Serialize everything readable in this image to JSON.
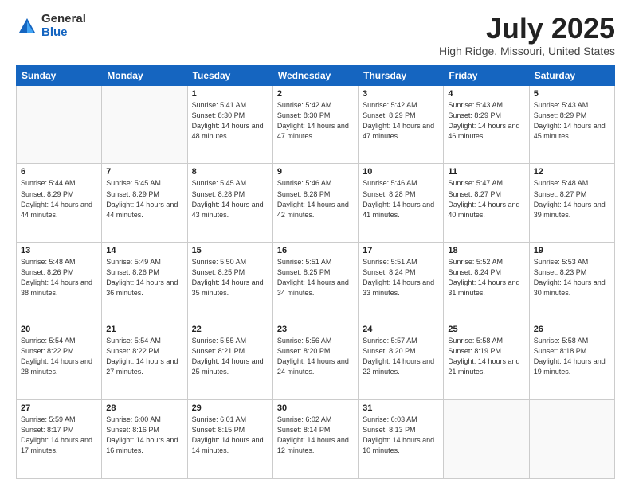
{
  "logo": {
    "general": "General",
    "blue": "Blue"
  },
  "title": "July 2025",
  "location": "High Ridge, Missouri, United States",
  "headers": [
    "Sunday",
    "Monday",
    "Tuesday",
    "Wednesday",
    "Thursday",
    "Friday",
    "Saturday"
  ],
  "weeks": [
    [
      {
        "day": "",
        "detail": ""
      },
      {
        "day": "",
        "detail": ""
      },
      {
        "day": "1",
        "detail": "Sunrise: 5:41 AM\nSunset: 8:30 PM\nDaylight: 14 hours and 48 minutes."
      },
      {
        "day": "2",
        "detail": "Sunrise: 5:42 AM\nSunset: 8:30 PM\nDaylight: 14 hours and 47 minutes."
      },
      {
        "day": "3",
        "detail": "Sunrise: 5:42 AM\nSunset: 8:29 PM\nDaylight: 14 hours and 47 minutes."
      },
      {
        "day": "4",
        "detail": "Sunrise: 5:43 AM\nSunset: 8:29 PM\nDaylight: 14 hours and 46 minutes."
      },
      {
        "day": "5",
        "detail": "Sunrise: 5:43 AM\nSunset: 8:29 PM\nDaylight: 14 hours and 45 minutes."
      }
    ],
    [
      {
        "day": "6",
        "detail": "Sunrise: 5:44 AM\nSunset: 8:29 PM\nDaylight: 14 hours and 44 minutes."
      },
      {
        "day": "7",
        "detail": "Sunrise: 5:45 AM\nSunset: 8:29 PM\nDaylight: 14 hours and 44 minutes."
      },
      {
        "day": "8",
        "detail": "Sunrise: 5:45 AM\nSunset: 8:28 PM\nDaylight: 14 hours and 43 minutes."
      },
      {
        "day": "9",
        "detail": "Sunrise: 5:46 AM\nSunset: 8:28 PM\nDaylight: 14 hours and 42 minutes."
      },
      {
        "day": "10",
        "detail": "Sunrise: 5:46 AM\nSunset: 8:28 PM\nDaylight: 14 hours and 41 minutes."
      },
      {
        "day": "11",
        "detail": "Sunrise: 5:47 AM\nSunset: 8:27 PM\nDaylight: 14 hours and 40 minutes."
      },
      {
        "day": "12",
        "detail": "Sunrise: 5:48 AM\nSunset: 8:27 PM\nDaylight: 14 hours and 39 minutes."
      }
    ],
    [
      {
        "day": "13",
        "detail": "Sunrise: 5:48 AM\nSunset: 8:26 PM\nDaylight: 14 hours and 38 minutes."
      },
      {
        "day": "14",
        "detail": "Sunrise: 5:49 AM\nSunset: 8:26 PM\nDaylight: 14 hours and 36 minutes."
      },
      {
        "day": "15",
        "detail": "Sunrise: 5:50 AM\nSunset: 8:25 PM\nDaylight: 14 hours and 35 minutes."
      },
      {
        "day": "16",
        "detail": "Sunrise: 5:51 AM\nSunset: 8:25 PM\nDaylight: 14 hours and 34 minutes."
      },
      {
        "day": "17",
        "detail": "Sunrise: 5:51 AM\nSunset: 8:24 PM\nDaylight: 14 hours and 33 minutes."
      },
      {
        "day": "18",
        "detail": "Sunrise: 5:52 AM\nSunset: 8:24 PM\nDaylight: 14 hours and 31 minutes."
      },
      {
        "day": "19",
        "detail": "Sunrise: 5:53 AM\nSunset: 8:23 PM\nDaylight: 14 hours and 30 minutes."
      }
    ],
    [
      {
        "day": "20",
        "detail": "Sunrise: 5:54 AM\nSunset: 8:22 PM\nDaylight: 14 hours and 28 minutes."
      },
      {
        "day": "21",
        "detail": "Sunrise: 5:54 AM\nSunset: 8:22 PM\nDaylight: 14 hours and 27 minutes."
      },
      {
        "day": "22",
        "detail": "Sunrise: 5:55 AM\nSunset: 8:21 PM\nDaylight: 14 hours and 25 minutes."
      },
      {
        "day": "23",
        "detail": "Sunrise: 5:56 AM\nSunset: 8:20 PM\nDaylight: 14 hours and 24 minutes."
      },
      {
        "day": "24",
        "detail": "Sunrise: 5:57 AM\nSunset: 8:20 PM\nDaylight: 14 hours and 22 minutes."
      },
      {
        "day": "25",
        "detail": "Sunrise: 5:58 AM\nSunset: 8:19 PM\nDaylight: 14 hours and 21 minutes."
      },
      {
        "day": "26",
        "detail": "Sunrise: 5:58 AM\nSunset: 8:18 PM\nDaylight: 14 hours and 19 minutes."
      }
    ],
    [
      {
        "day": "27",
        "detail": "Sunrise: 5:59 AM\nSunset: 8:17 PM\nDaylight: 14 hours and 17 minutes."
      },
      {
        "day": "28",
        "detail": "Sunrise: 6:00 AM\nSunset: 8:16 PM\nDaylight: 14 hours and 16 minutes."
      },
      {
        "day": "29",
        "detail": "Sunrise: 6:01 AM\nSunset: 8:15 PM\nDaylight: 14 hours and 14 minutes."
      },
      {
        "day": "30",
        "detail": "Sunrise: 6:02 AM\nSunset: 8:14 PM\nDaylight: 14 hours and 12 minutes."
      },
      {
        "day": "31",
        "detail": "Sunrise: 6:03 AM\nSunset: 8:13 PM\nDaylight: 14 hours and 10 minutes."
      },
      {
        "day": "",
        "detail": ""
      },
      {
        "day": "",
        "detail": ""
      }
    ]
  ]
}
